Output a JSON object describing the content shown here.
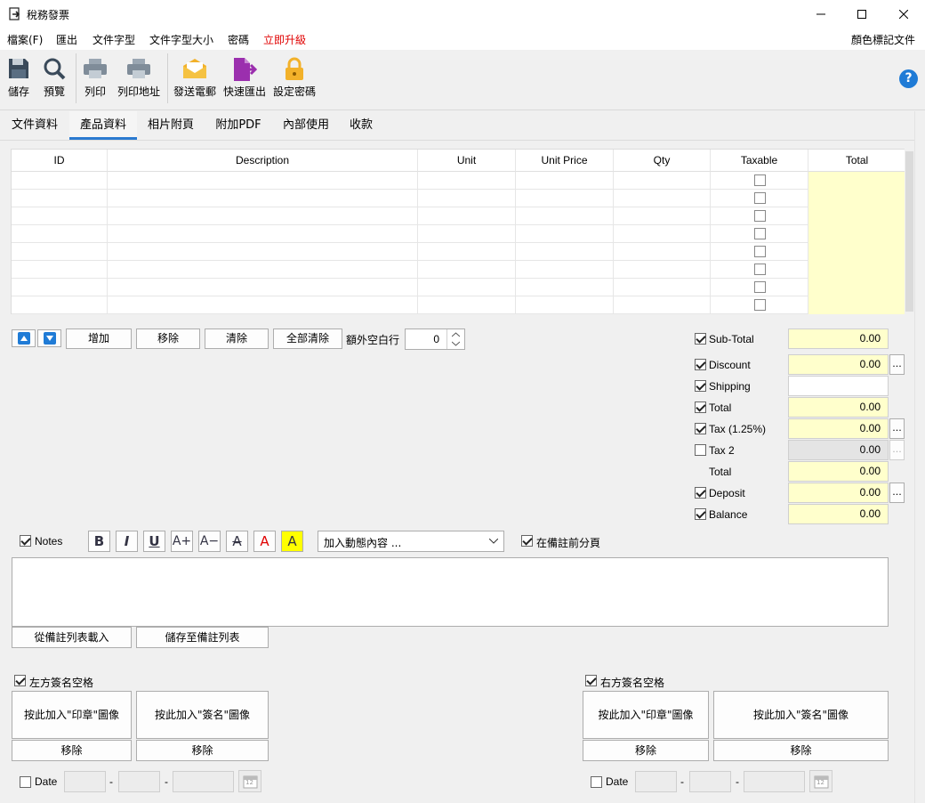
{
  "window": {
    "title": "稅務發票",
    "minimize_glyph": "—",
    "maximize_glyph": "☐",
    "close_glyph": "✕"
  },
  "menu": {
    "items": [
      "檔案(F)",
      "匯出",
      "文件字型",
      "文件字型大小",
      "密碼",
      "立即升級"
    ],
    "right": "顏色標記文件",
    "upgrade_color": "#e00000"
  },
  "toolbar": {
    "items": [
      {
        "label": "儲存",
        "icon": "save-icon"
      },
      {
        "label": "預覽",
        "icon": "magnifier-icon"
      },
      {
        "label": "列印",
        "icon": "printer-icon"
      },
      {
        "label": "列印地址",
        "icon": "printer-icon"
      },
      {
        "label": "發送電郵",
        "icon": "envelope-icon"
      },
      {
        "label": "快速匯出",
        "icon": "export-icon"
      },
      {
        "label": "設定密碼",
        "icon": "lock-icon"
      }
    ],
    "help_glyph": "?"
  },
  "tabs": [
    "文件資料",
    "產品資料",
    "相片附頁",
    "附加PDF",
    "內部使用",
    "收款"
  ],
  "active_tab": 1,
  "grid": {
    "columns": [
      "ID",
      "Description",
      "Unit",
      "Unit Price",
      "Qty",
      "Taxable",
      "Total"
    ],
    "row_count": 8
  },
  "row_controls": {
    "add": "增加",
    "remove": "移除",
    "clear": "清除",
    "clear_all": "全部清除",
    "extra_blank_label": "額外空白行",
    "extra_blank_value": "0"
  },
  "totals": [
    {
      "label": "Sub-Total",
      "value": "0.00",
      "checked": true
    },
    {
      "label": "Discount",
      "value": "0.00",
      "checked": true,
      "more": "..."
    },
    {
      "label": "Shipping",
      "value": "",
      "checked": true
    },
    {
      "label": "Total",
      "value": "0.00",
      "checked": true
    },
    {
      "label": "Tax (1.25%)",
      "value": "0.00",
      "checked": true,
      "more": "..."
    },
    {
      "label": "Tax 2",
      "value": "0.00",
      "checked": false,
      "more": "..."
    },
    {
      "label": "Total",
      "value": "0.00",
      "checked": null
    },
    {
      "label": "Deposit",
      "value": "0.00",
      "checked": true,
      "more": "..."
    },
    {
      "label": "Balance",
      "value": "0.00",
      "checked": true
    }
  ],
  "notes": {
    "label": "Notes",
    "format_buttons": [
      {
        "name": "bold",
        "glyph": "B"
      },
      {
        "name": "italic",
        "glyph": "I"
      },
      {
        "name": "underline",
        "glyph": "U"
      },
      {
        "name": "font-larger",
        "glyph": "A+"
      },
      {
        "name": "font-smaller",
        "glyph": "A−"
      },
      {
        "name": "strikethrough",
        "glyph": "A"
      },
      {
        "name": "font-color",
        "glyph": "A"
      },
      {
        "name": "highlight",
        "glyph": "A"
      }
    ],
    "dynamic_placeholder": "加入動態內容 ...",
    "page_break_label": "在備註前分頁",
    "load_button": "從備註列表載入",
    "save_button": "儲存至備註列表"
  },
  "signatures": {
    "left": {
      "label": "左方簽名空格",
      "stamp_button": "按此加入\"印章\"圖像",
      "sign_button": "按此加入\"簽名\"圖像",
      "remove": "移除",
      "date_label": "Date"
    },
    "right": {
      "label": "右方簽名空格",
      "stamp_button": "按此加入\"印章\"圖像",
      "sign_button": "按此加入\"簽名\"圖像",
      "remove": "移除",
      "date_label": "Date"
    },
    "date_sep": "-",
    "calendar_day": "12"
  }
}
